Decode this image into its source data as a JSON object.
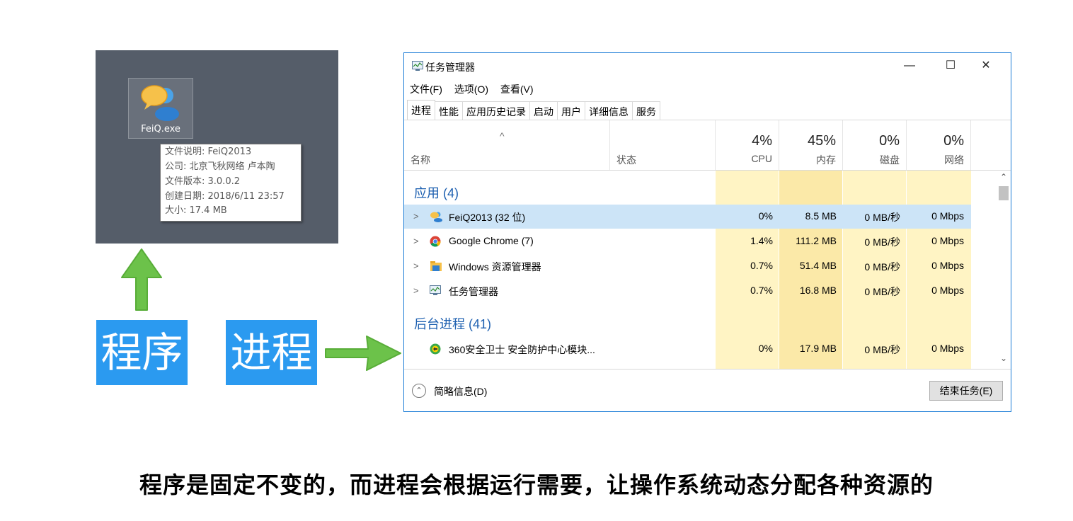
{
  "desktop": {
    "icon_label": "FeiQ.exe",
    "tooltip": [
      "文件说明: FeiQ2013",
      "公司: 北京飞秋网络 卢本陶",
      "文件版本: 3.0.0.2",
      "创建日期: 2018/6/11 23:57",
      "大小: 17.4 MB"
    ]
  },
  "labels": {
    "program": "程序",
    "process": "进程"
  },
  "caption": "程序是固定不变的，而进程会根据运行需要，让操作系统动态分配各种资源的",
  "colors": {
    "label_bg": "#2b9af0",
    "arrow": "#6cc24a",
    "window_border": "#1c7cd6",
    "group_text": "#1c5fb0",
    "cpu_col": "#fff4c4",
    "mem_col": "#fbe9a8",
    "selected_row": "#cce4f7"
  },
  "taskmgr": {
    "title": "任务管理器",
    "controls": {
      "minimize": "—",
      "maximize": "☐",
      "close": "✕"
    },
    "menu": [
      "文件(F)",
      "选项(O)",
      "查看(V)"
    ],
    "tabs": [
      "进程",
      "性能",
      "应用历史记录",
      "启动",
      "用户",
      "详细信息",
      "服务"
    ],
    "active_tab": "进程",
    "sort_caret": "^",
    "columns": {
      "name": "名称",
      "status": "状态",
      "cpu": {
        "pct": "4%",
        "label": "CPU"
      },
      "mem": {
        "pct": "45%",
        "label": "内存"
      },
      "disk": {
        "pct": "0%",
        "label": "磁盘"
      },
      "net": {
        "pct": "0%",
        "label": "网络"
      }
    },
    "groups": {
      "apps": "应用 (4)",
      "background": "后台进程 (41)"
    },
    "apps": [
      {
        "name": "FeiQ2013 (32 位)",
        "icon": "feiq-icon",
        "cpu": "0%",
        "mem": "8.5 MB",
        "disk": "0 MB/秒",
        "net": "0 Mbps"
      },
      {
        "name": "Google Chrome (7)",
        "icon": "chrome-icon",
        "cpu": "1.4%",
        "mem": "111.2 MB",
        "disk": "0 MB/秒",
        "net": "0 Mbps"
      },
      {
        "name": "Windows 资源管理器",
        "icon": "explorer-icon",
        "cpu": "0.7%",
        "mem": "51.4 MB",
        "disk": "0 MB/秒",
        "net": "0 Mbps"
      },
      {
        "name": "任务管理器",
        "icon": "taskmgr-icon",
        "cpu": "0.7%",
        "mem": "16.8 MB",
        "disk": "0 MB/秒",
        "net": "0 Mbps"
      }
    ],
    "background": [
      {
        "name": "360安全卫士 安全防护中心模块...",
        "icon": "360-icon",
        "cpu": "0%",
        "mem": "17.9 MB",
        "disk": "0 MB/秒",
        "net": "0 Mbps"
      }
    ],
    "footer": {
      "fewer_details": "简略信息(D)",
      "end_task": "结束任务(E)"
    }
  }
}
